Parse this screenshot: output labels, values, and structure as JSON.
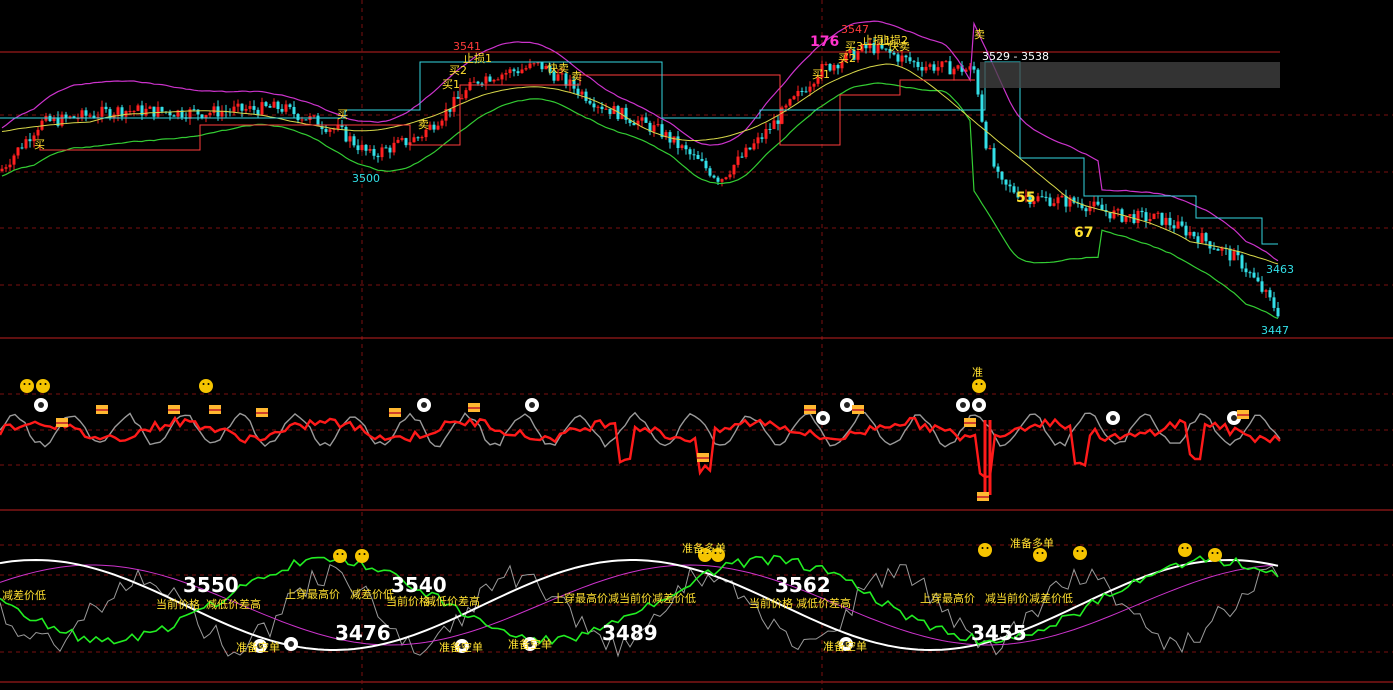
{
  "colors": {
    "background": "#000000",
    "up": "#ff2020",
    "down": "#33e0e8",
    "upper_band": "#cc33cc",
    "lower_band": "#33cc33",
    "mid_line": "#d8d84a",
    "stop_line": "#ff3b3b",
    "step_line": "#35d6e0",
    "grid": "#7a1010",
    "osc_red": "#ff1a1a",
    "osc_gray": "#9a9a9a",
    "green_line": "#22ee22",
    "white_line": "#ffffff",
    "label_yellow": "#ffe030",
    "label_cyan": "#33e0e8",
    "label_magenta": "#ff33cc"
  },
  "chart_data": [
    {
      "type": "candlestick",
      "panel": "price",
      "ylim": [
        3440,
        3560
      ],
      "price_labels": [
        "3541",
        "3500",
        "3547",
        "3529 - 3538",
        "3463",
        "3447"
      ],
      "counts": [
        "176",
        "55",
        "67"
      ],
      "signals": [
        "买",
        "买1",
        "买2",
        "止损1",
        "快卖",
        "卖",
        "买",
        "卖",
        "买1",
        "买2",
        "买3",
        "止损1",
        "止损2",
        "快卖",
        "卖"
      ],
      "series": [
        {
          "name": "close",
          "anchors_x": [
            0,
            40,
            120,
            200,
            280,
            340,
            370,
            420,
            480,
            540,
            600,
            660,
            720,
            760,
            820,
            870,
            920,
            975,
            985,
            1000,
            1030,
            1080,
            1120,
            1160,
            1200,
            1240,
            1278
          ],
          "anchors_y": [
            3500,
            3518,
            3523,
            3522,
            3524,
            3515,
            3506,
            3513,
            3535,
            3540,
            3525,
            3515,
            3497,
            3512,
            3538,
            3547,
            3540,
            3538,
            3512,
            3495,
            3490,
            3488,
            3483,
            3482,
            3475,
            3466,
            3447
          ]
        }
      ]
    },
    {
      "type": "line",
      "panel": "oscillator",
      "legend": [],
      "note_label": "准"
    },
    {
      "type": "line",
      "panel": "indicator",
      "values": [
        "3550",
        "3540",
        "3562",
        "3476",
        "3489",
        "3455"
      ],
      "annotations": [
        "减差价低",
        "当前价格",
        "减低价差高",
        "上穿最高价",
        "减差价低",
        "当前价格",
        "减低价差高",
        "上穿最高价",
        "减当前价减差价低",
        "当前价格",
        "减低价差高",
        "上穿最高价",
        "减当前价减差价低",
        "准备空单",
        "准备空单",
        "准备空单",
        "准备空单",
        "准备多单",
        "准备多单"
      ]
    }
  ]
}
